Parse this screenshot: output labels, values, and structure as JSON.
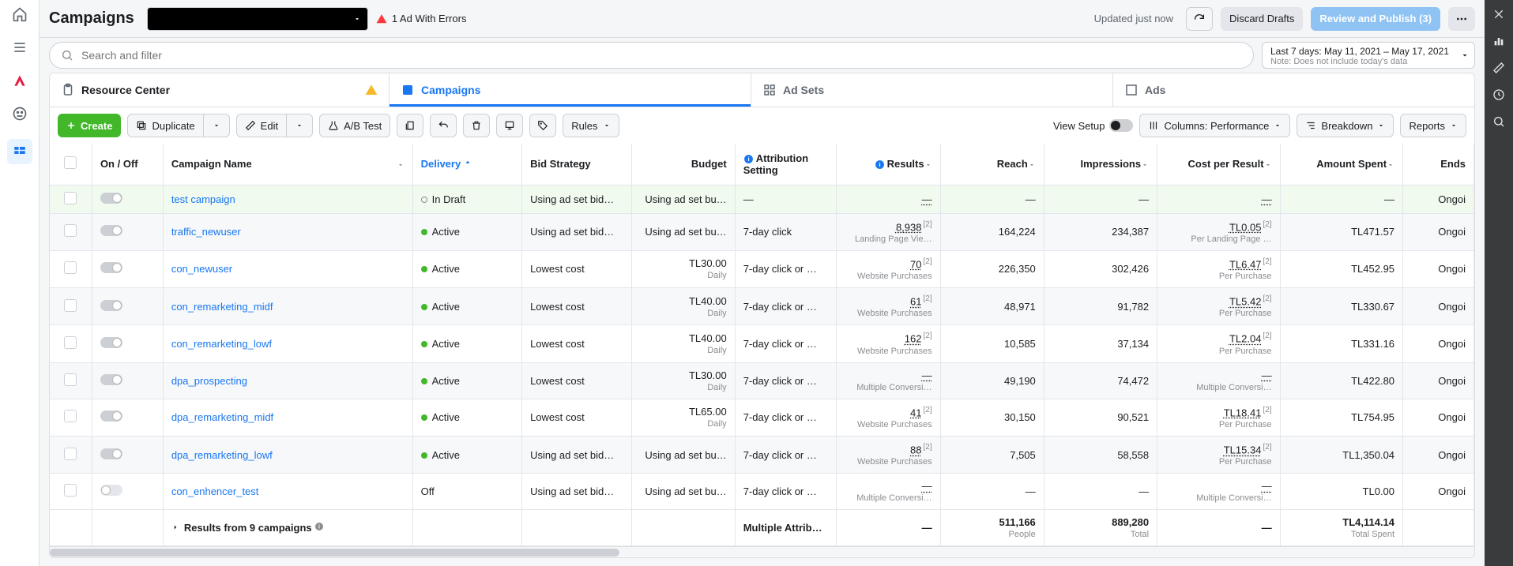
{
  "header": {
    "title": "Campaigns",
    "errors_label": "1 Ad With Errors",
    "updated_label": "Updated just now",
    "discard_label": "Discard Drafts",
    "review_label": "Review and Publish (3)"
  },
  "search": {
    "placeholder": "Search and filter",
    "date_line": "Last 7 days: May 11, 2021 – May 17, 2021",
    "date_note": "Note: Does not include today's data"
  },
  "tabs": {
    "resource_center": "Resource Center",
    "campaigns": "Campaigns",
    "adsets": "Ad Sets",
    "ads": "Ads"
  },
  "toolbar": {
    "create": "Create",
    "duplicate": "Duplicate",
    "edit": "Edit",
    "abtest": "A/B Test",
    "rules": "Rules",
    "view_setup": "View Setup",
    "columns": "Columns: Performance",
    "breakdown": "Breakdown",
    "reports": "Reports"
  },
  "columns": {
    "onoff": "On / Off",
    "name": "Campaign Name",
    "delivery": "Delivery",
    "bid": "Bid Strategy",
    "budget": "Budget",
    "attr": "Attribution Setting",
    "results": "Results",
    "reach": "Reach",
    "impr": "Impressions",
    "cpr": "Cost per Result",
    "spent": "Amount Spent",
    "ends": "Ends"
  },
  "rows": [
    {
      "highlight": true,
      "on": true,
      "name": "test campaign",
      "status": "In Draft",
      "status_dot": "gray",
      "bid": "Using ad set bid…",
      "budget": "Using ad set bu…",
      "budget_sub": "",
      "attr": "—",
      "results": "—",
      "results_sub": "",
      "sup": "",
      "reach": "—",
      "impr": "—",
      "cpr": "—",
      "cpr_sub": "",
      "spent": "—",
      "ends": "Ongoi"
    },
    {
      "on": true,
      "name": "traffic_newuser",
      "status": "Active",
      "status_dot": "green",
      "bid": "Using ad set bid…",
      "budget": "Using ad set bu…",
      "budget_sub": "",
      "attr": "7-day click",
      "results": "8,938",
      "results_sub": "Landing Page Vie…",
      "sup": "[2]",
      "reach": "164,224",
      "impr": "234,387",
      "cpr": "TL0.05",
      "cpr_sup": "[2]",
      "cpr_sub": "Per Landing Page …",
      "spent": "TL471.57",
      "ends": "Ongoi"
    },
    {
      "on": true,
      "name": "con_newuser",
      "status": "Active",
      "status_dot": "green",
      "bid": "Lowest cost",
      "budget": "TL30.00",
      "budget_sub": "Daily",
      "attr": "7-day click or …",
      "results": "70",
      "results_sub": "Website Purchases",
      "sup": "[2]",
      "reach": "226,350",
      "impr": "302,426",
      "cpr": "TL6.47",
      "cpr_sup": "[2]",
      "cpr_sub": "Per Purchase",
      "spent": "TL452.95",
      "ends": "Ongoi"
    },
    {
      "on": true,
      "name": "con_remarketing_midf",
      "status": "Active",
      "status_dot": "green",
      "bid": "Lowest cost",
      "budget": "TL40.00",
      "budget_sub": "Daily",
      "attr": "7-day click or …",
      "results": "61",
      "results_sub": "Website Purchases",
      "sup": "[2]",
      "reach": "48,971",
      "impr": "91,782",
      "cpr": "TL5.42",
      "cpr_sup": "[2]",
      "cpr_sub": "Per Purchase",
      "spent": "TL330.67",
      "ends": "Ongoi"
    },
    {
      "on": true,
      "name": "con_remarketing_lowf",
      "status": "Active",
      "status_dot": "green",
      "bid": "Lowest cost",
      "budget": "TL40.00",
      "budget_sub": "Daily",
      "attr": "7-day click or …",
      "results": "162",
      "results_sub": "Website Purchases",
      "sup": "[2]",
      "reach": "10,585",
      "impr": "37,134",
      "cpr": "TL2.04",
      "cpr_sup": "[2]",
      "cpr_sub": "Per Purchase",
      "spent": "TL331.16",
      "ends": "Ongoi"
    },
    {
      "on": true,
      "name": "dpa_prospecting",
      "status": "Active",
      "status_dot": "green",
      "bid": "Lowest cost",
      "budget": "TL30.00",
      "budget_sub": "Daily",
      "attr": "7-day click or …",
      "results": "—",
      "results_sub": "Multiple Conversi…",
      "sup": "",
      "reach": "49,190",
      "impr": "74,472",
      "cpr": "—",
      "cpr_sub": "Multiple Conversi…",
      "spent": "TL422.80",
      "ends": "Ongoi"
    },
    {
      "on": true,
      "name": "dpa_remarketing_midf",
      "status": "Active",
      "status_dot": "green",
      "bid": "Lowest cost",
      "budget": "TL65.00",
      "budget_sub": "Daily",
      "attr": "7-day click or …",
      "results": "41",
      "results_sub": "Website Purchases",
      "sup": "[2]",
      "reach": "30,150",
      "impr": "90,521",
      "cpr": "TL18.41",
      "cpr_sup": "[2]",
      "cpr_sub": "Per Purchase",
      "spent": "TL754.95",
      "ends": "Ongoi"
    },
    {
      "on": true,
      "name": "dpa_remarketing_lowf",
      "status": "Active",
      "status_dot": "green",
      "bid": "Using ad set bid…",
      "budget": "Using ad set bu…",
      "budget_sub": "",
      "attr": "7-day click or …",
      "results": "88",
      "results_sub": "Website Purchases",
      "sup": "[2]",
      "reach": "7,505",
      "impr": "58,558",
      "cpr": "TL15.34",
      "cpr_sup": "[2]",
      "cpr_sub": "Per Purchase",
      "spent": "TL1,350.04",
      "ends": "Ongoi"
    },
    {
      "on": false,
      "name": "con_enhencer_test",
      "status": "Off",
      "status_dot": "",
      "bid": "Using ad set bid…",
      "budget": "Using ad set bu…",
      "budget_sub": "",
      "attr": "7-day click or …",
      "results": "—",
      "results_sub": "Multiple Conversi…",
      "sup": "",
      "reach": "—",
      "impr": "—",
      "cpr": "—",
      "cpr_sub": "Multiple Conversi…",
      "spent": "TL0.00",
      "ends": "Ongoi"
    }
  ],
  "summary": {
    "label": "Results from 9 campaigns",
    "attr": "Multiple Attrib…",
    "results": "—",
    "reach": "511,166",
    "reach_sub": "People",
    "impr": "889,280",
    "impr_sub": "Total",
    "cpr": "—",
    "spent": "TL4,114.14",
    "spent_sub": "Total Spent"
  }
}
